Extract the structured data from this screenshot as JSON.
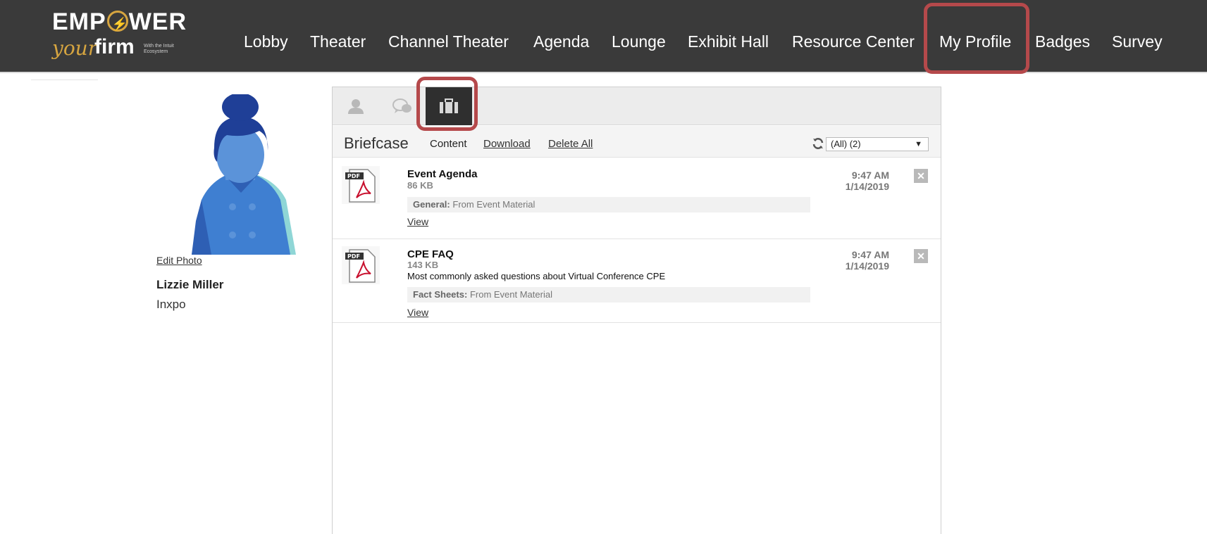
{
  "logo": {
    "line1": "EMP",
    "line1b": "WER",
    "your": "your",
    "firm": "firm",
    "with": "With the Intuit Ecosystem"
  },
  "nav": {
    "items": [
      "Lobby",
      "Theater",
      "Channel Theater",
      "Agenda",
      "Lounge",
      "Exhibit Hall",
      "Resource Center",
      "My Profile",
      "Badges",
      "Survey"
    ],
    "active": "My Profile"
  },
  "profile": {
    "edit_photo": "Edit Photo",
    "name": "Lizzie Miller",
    "company": "Inxpo"
  },
  "tabs": [
    {
      "icon": "profile-icon",
      "active": false
    },
    {
      "icon": "chat-icon",
      "active": false
    },
    {
      "icon": "briefcase-icon",
      "active": true
    }
  ],
  "briefcase": {
    "title": "Briefcase",
    "content_label": "Content",
    "download_label": "Download",
    "delete_all_label": "Delete All",
    "filter_value": "(All) (2)"
  },
  "items": [
    {
      "title": "Event Agenda",
      "size": "86 KB",
      "description": "",
      "category": "General:",
      "source": "From Event Material",
      "view_label": "View",
      "time": "9:47 AM",
      "date": "1/14/2019",
      "close": "✕"
    },
    {
      "title": "CPE FAQ",
      "size": "143 KB",
      "description": "Most commonly asked questions about Virtual Conference CPE",
      "category": "Fact Sheets:",
      "source": "From Event Material",
      "view_label": "View",
      "time": "9:47 AM",
      "date": "1/14/2019",
      "close": "✕"
    }
  ],
  "colors": {
    "topbar": "#3a3a3a",
    "accent_gold": "#d6a540",
    "highlight": "#b5494b",
    "avatar_blue": "#3f7fd1"
  }
}
